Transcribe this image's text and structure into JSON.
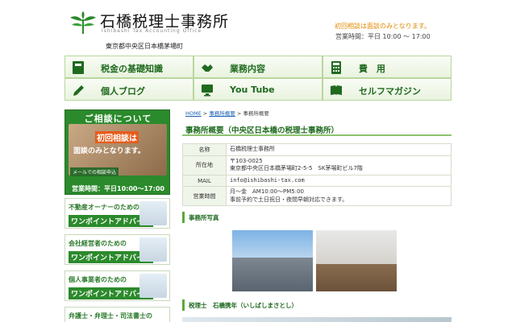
{
  "header": {
    "logo_title": "石橋税理士事務所",
    "logo_sub": "Ishibashi Tax Accounting Office",
    "address": "東京都中央区日本橋茅場町",
    "note": "初回相談は面談のみとなります。",
    "hours": "営業時間：平日 10:00 〜 17:00"
  },
  "nav": [
    {
      "label": "税金の基礎知識",
      "icon": "book-icon"
    },
    {
      "label": "業務内容",
      "icon": "handshake-icon"
    },
    {
      "label": "費　用",
      "icon": "calculator-icon"
    },
    {
      "label": "個人ブログ",
      "icon": "pencil-icon"
    },
    {
      "label": "You Tube",
      "icon": "monitor-icon"
    },
    {
      "label": "セルフマガジン",
      "icon": "open-book-icon"
    }
  ],
  "sidebar": {
    "consult_title": "ご相談について",
    "consult_hl1": "初回相談は",
    "consult_hl2": "面談のみとなります。",
    "consult_mail": "メールでの相談申込",
    "consult_hours": "営業時間：平日10:00〜17:00",
    "banners": [
      {
        "t1": "不動産オーナーのための",
        "t2": "ワンポイントアドバイス"
      },
      {
        "t1": "会社経営者のための",
        "t2": "ワンポイントアドバイス"
      },
      {
        "t1": "個人事業者のための",
        "t2": "ワンポイントアドバイス"
      },
      {
        "t1": "弁護士・弁理士・司法書士の",
        "t2": ""
      }
    ]
  },
  "breadcrumb": {
    "home": "HOME",
    "sep1": " > ",
    "mid": "事務所概要",
    "sep2": " > ",
    "current": "事務所概要"
  },
  "main": {
    "title": "事務所概要（中央区日本橋の税理士事務所）",
    "rows": [
      {
        "label": "名称",
        "lines": [
          "石橋税理士事務所"
        ]
      },
      {
        "label": "所在地",
        "lines": [
          "〒103-0025",
          "東京都中央区日本橋茅場町2-5-5　SK茅場町ビル7階"
        ]
      },
      {
        "label": "MAIL",
        "lines": [
          "info@ishibashi-tax.com"
        ]
      },
      {
        "label": "営業時間",
        "lines": [
          "月～金　AM10:00～PM5:00",
          "事前予約で土日祝日・夜間早朝対応できます。"
        ]
      }
    ],
    "photos_heading": "事務所写真",
    "profile_heading": "税理士　石橋携年（いしばしまさとし）"
  }
}
